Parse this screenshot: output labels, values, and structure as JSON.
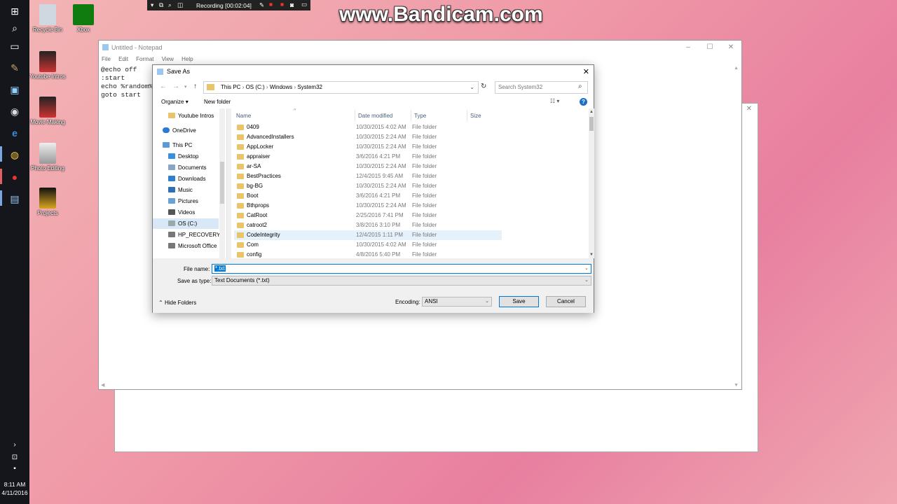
{
  "bandicam": {
    "recording": "Recording [00:02:04]",
    "watermark": "www.Bandicam.com"
  },
  "taskbar": {
    "time": "8:11 AM",
    "date": "4/11/2016"
  },
  "desktop_icons": [
    {
      "label": "Recycle Bin"
    },
    {
      "label": "Xbox"
    },
    {
      "label": "Youtube Intros"
    },
    {
      "label": "Movie Making"
    },
    {
      "label": "Photo Editing"
    },
    {
      "label": "Projects"
    }
  ],
  "notepad": {
    "title": "Untitled - Notepad",
    "menu": [
      "File",
      "Edit",
      "Format",
      "View",
      "Help"
    ],
    "text": "@echo off\n:start\necho %random%\ngoto start"
  },
  "dialog": {
    "title": "Save As",
    "breadcrumb": [
      "This PC",
      "OS (C:)",
      "Windows",
      "System32"
    ],
    "search_placeholder": "Search System32",
    "organize_label": "Organize",
    "new_folder_label": "New folder",
    "nav_pane": [
      "Youtube Intros",
      "OneDrive",
      "This PC",
      "Desktop",
      "Documents",
      "Downloads",
      "Music",
      "Pictures",
      "Videos",
      "OS (C:)",
      "HP_RECOVERY (",
      "Microsoft Office"
    ],
    "columns": [
      "Name",
      "Date modified",
      "Type",
      "Size"
    ],
    "files": [
      {
        "name": "0409",
        "date": "10/30/2015 4:02 AM",
        "type": "File folder"
      },
      {
        "name": "AdvancedInstallers",
        "date": "10/30/2015 2:24 AM",
        "type": "File folder"
      },
      {
        "name": "AppLocker",
        "date": "10/30/2015 2:24 AM",
        "type": "File folder"
      },
      {
        "name": "appraiser",
        "date": "3/6/2016 4:21 PM",
        "type": "File folder"
      },
      {
        "name": "ar-SA",
        "date": "10/30/2015 2:24 AM",
        "type": "File folder"
      },
      {
        "name": "BestPractices",
        "date": "12/4/2015 9:45 AM",
        "type": "File folder"
      },
      {
        "name": "bg-BG",
        "date": "10/30/2015 2:24 AM",
        "type": "File folder"
      },
      {
        "name": "Boot",
        "date": "3/6/2016 4:21 PM",
        "type": "File folder"
      },
      {
        "name": "Bthprops",
        "date": "10/30/2015 2:24 AM",
        "type": "File folder"
      },
      {
        "name": "CatRoot",
        "date": "2/25/2016 7:41 PM",
        "type": "File folder"
      },
      {
        "name": "catroot2",
        "date": "3/8/2016 3:10 PM",
        "type": "File folder"
      },
      {
        "name": "CodeIntegrity",
        "date": "12/4/2015 1:11 PM",
        "type": "File folder"
      },
      {
        "name": "Com",
        "date": "10/30/2015 4:02 AM",
        "type": "File folder"
      },
      {
        "name": "config",
        "date": "4/8/2016 5:40 PM",
        "type": "File folder"
      }
    ],
    "selected_index": 11,
    "file_name_label": "File name:",
    "file_name_value": "*.txt",
    "save_as_type_label": "Save as type:",
    "save_as_type_value": "Text Documents (*.txt)",
    "hide_folders_label": "Hide Folders",
    "encoding_label": "Encoding:",
    "encoding_value": "ANSI",
    "save_label": "Save",
    "cancel_label": "Cancel"
  },
  "colors": {
    "selection": "#e5f1fb",
    "folder": "#e9c46a",
    "accent": "#0078d7"
  }
}
